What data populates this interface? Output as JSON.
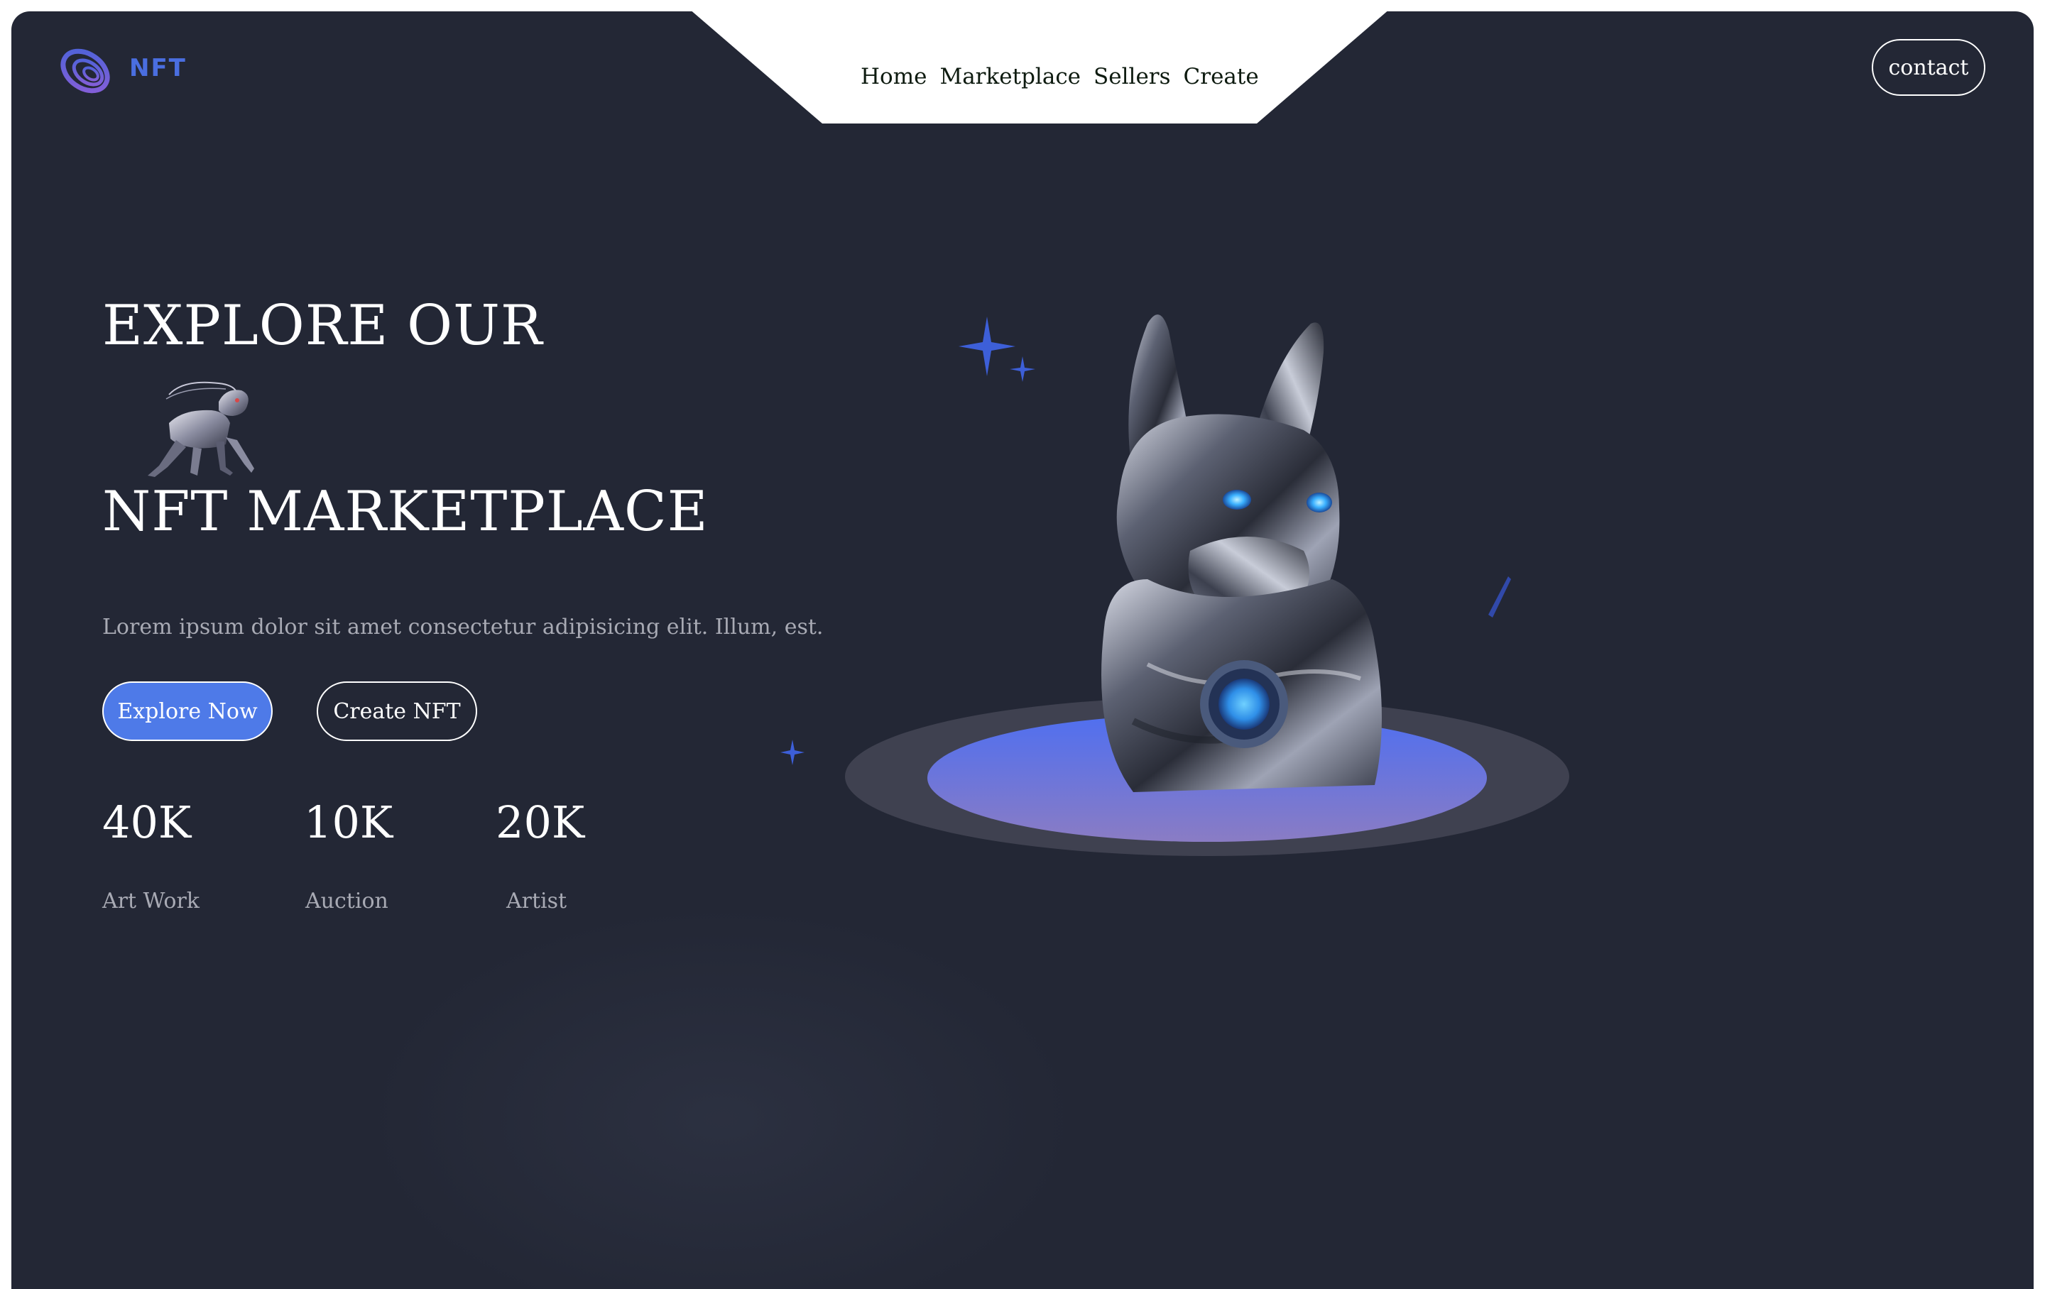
{
  "logo": {
    "text": "NFT",
    "icon": "orbit-rings-logo-icon"
  },
  "nav": {
    "items": [
      {
        "label": "Home"
      },
      {
        "label": "Marketplace"
      },
      {
        "label": "Sellers"
      },
      {
        "label": "Create"
      }
    ]
  },
  "header": {
    "contact_label": "contact"
  },
  "hero": {
    "title_line1": "EXPLORE OUR",
    "title_line2": "NFT MARKETPLACE",
    "description": "Lorem ipsum dolor sit amet consectetur adipisicing elit. Illum, est.",
    "primary_button": "Explore Now",
    "secondary_button": "Create NFT",
    "inline_image": "robot-creature-image",
    "main_image": "chrome-dog-bust-image"
  },
  "stats": [
    {
      "value": "40K",
      "label": "Art Work"
    },
    {
      "value": "10K",
      "label": "Auction"
    },
    {
      "value": "20K",
      "label": "Artist"
    }
  ],
  "colors": {
    "background": "#232735",
    "accent": "#4e7ae8",
    "logo": "#4a6ee0",
    "nav_bg": "#ffffff",
    "muted_text": "#a8aab4"
  }
}
